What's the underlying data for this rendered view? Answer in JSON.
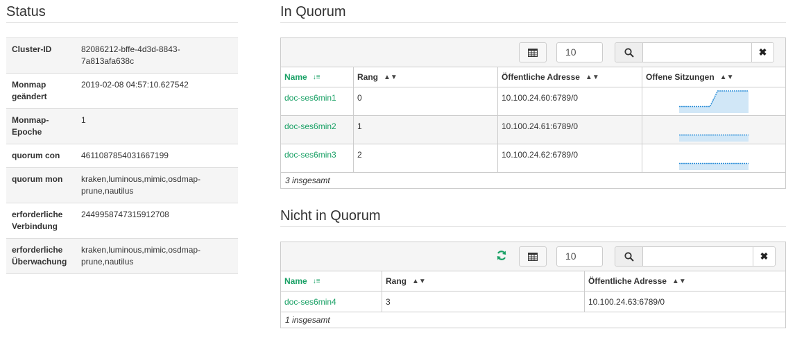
{
  "status": {
    "title": "Status",
    "rows": [
      {
        "key": "Cluster-ID",
        "value": "82086212-bffe-4d3d-8843-7a813afa638c"
      },
      {
        "key": "Monmap geändert",
        "value": "2019-02-08 04:57:10.627542"
      },
      {
        "key": "Monmap-Epoche",
        "value": "1"
      },
      {
        "key": "quorum con",
        "value": "4611087854031667199"
      },
      {
        "key": "quorum mon",
        "value": "kraken,luminous,mimic,osdmap-prune,nautilus"
      },
      {
        "key": "erforderliche Verbindung",
        "value": "2449958747315912708"
      },
      {
        "key": "erforderliche Überwachung",
        "value": "kraken,luminous,mimic,osdmap-prune,nautilus"
      }
    ]
  },
  "quorum": {
    "title": "In Quorum",
    "page_size": "10",
    "search_placeholder": "",
    "columns": [
      "Name",
      "Rang",
      "Öffentliche Adresse",
      "Offene Sitzungen"
    ],
    "rows": [
      {
        "name": "doc-ses6min1",
        "rank": "0",
        "address": "10.100.24.60:6789/0",
        "sessions": [
          1,
          1,
          1,
          1,
          1,
          4,
          4,
          4,
          4,
          4
        ]
      },
      {
        "name": "doc-ses6min2",
        "rank": "1",
        "address": "10.100.24.61:6789/0",
        "sessions": [
          1,
          1,
          1,
          1,
          1,
          1,
          1,
          1,
          1,
          1
        ]
      },
      {
        "name": "doc-ses6min3",
        "rank": "2",
        "address": "10.100.24.62:6789/0",
        "sessions": [
          1,
          1,
          1,
          1,
          1,
          1,
          1,
          1,
          1,
          1
        ]
      }
    ],
    "footer_count": "3",
    "footer_label": "insgesamt"
  },
  "not_quorum": {
    "title": "Nicht in Quorum",
    "page_size": "10",
    "columns": [
      "Name",
      "Rang",
      "Öffentliche Adresse"
    ],
    "rows": [
      {
        "name": "doc-ses6min4",
        "rank": "3",
        "address": "10.100.24.63:6789/0"
      }
    ],
    "footer_count": "1",
    "footer_label": "insgesamt"
  },
  "icons": {
    "table": "table-columns-icon",
    "search": "search-icon",
    "clear": "close-icon",
    "refresh": "refresh-icon",
    "sort_asc": "sort-amount-asc-icon",
    "sort": "sort-icon"
  },
  "colors": {
    "accent": "#1aa166",
    "spark_fill": "#d1e7f7",
    "spark_line": "#2e8fd8"
  }
}
